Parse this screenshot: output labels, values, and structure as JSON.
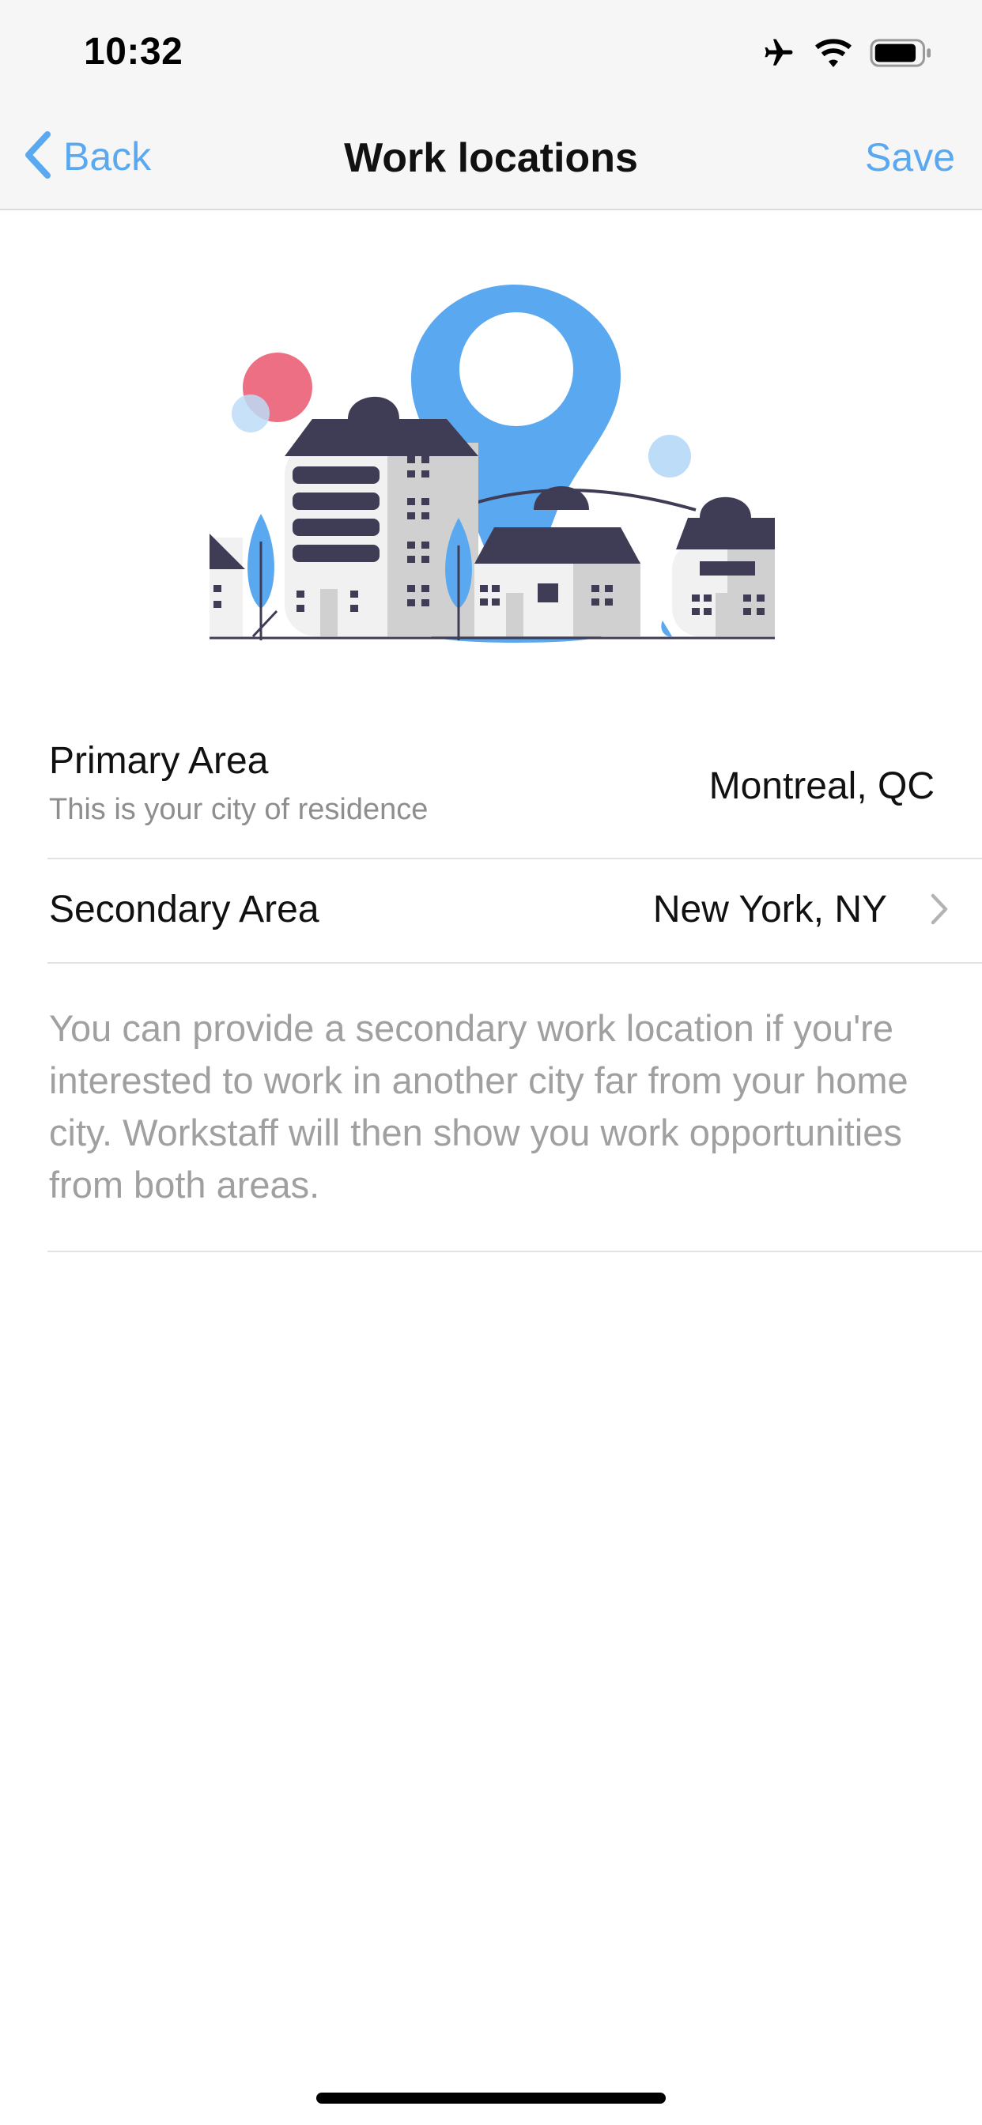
{
  "status_bar": {
    "time": "10:32",
    "icons": [
      "airplane-icon",
      "wifi-icon",
      "battery-icon"
    ]
  },
  "nav": {
    "back_label": "Back",
    "title": "Work locations",
    "save_label": "Save"
  },
  "illustration": {
    "name": "city-location-illustration",
    "colors": {
      "pin": "#5aa9f0",
      "dark": "#3f3d56",
      "building_light": "#f1f1f1",
      "building_mid": "#d0d0d0",
      "pink": "#ec6f83",
      "light_blue": "#bcdcf7"
    }
  },
  "primary_area": {
    "label": "Primary Area",
    "sublabel": "This is your city of residence",
    "value": "Montreal, QC"
  },
  "secondary_area": {
    "label": "Secondary Area",
    "value": "New York, NY"
  },
  "description": "You can provide a secondary work location if you're interested to work in another city far from your home city. Workstaff will then show you work opportunities from both areas.",
  "colors": {
    "accent": "#5aa9f0",
    "bar_background": "#f6f6f6",
    "muted_text": "#a0a0a0"
  }
}
